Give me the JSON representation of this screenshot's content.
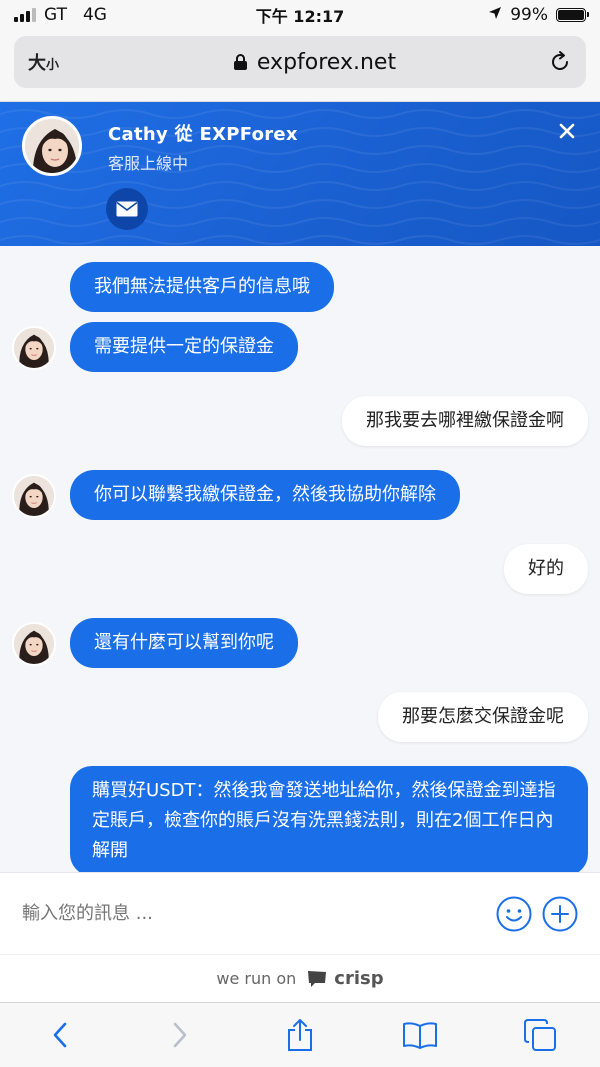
{
  "status_bar": {
    "carrier": "GT",
    "network": "4G",
    "time": "下午 12:17",
    "battery": "99%"
  },
  "browser": {
    "text_size_label": "大",
    "text_size_small": "小",
    "url": "expforex.net"
  },
  "chat": {
    "agent_name": "Cathy 從 EXPForex",
    "agent_status": "客服上線中",
    "messages": [
      {
        "from": "operator",
        "text": "我們無法提供客戶的信息哦"
      },
      {
        "from": "operator",
        "text": "需要提供一定的保證金"
      },
      {
        "from": "visitor",
        "text": "那我要去哪裡繳保證金啊"
      },
      {
        "from": "operator",
        "text": "你可以聯繫我繳保證金，然後我協助你解除"
      },
      {
        "from": "visitor",
        "text": "好的"
      },
      {
        "from": "operator",
        "text": "還有什麼可以幫到你呢"
      },
      {
        "from": "visitor",
        "text": "那要怎麼交保證金呢"
      },
      {
        "from": "operator",
        "text": "購買好USDT：然後我會發送地址給你，然後保證金到達指定賬戶，檢查你的賬戶沒有洗黑錢法則，則在2個工作日內解開"
      }
    ],
    "composer_placeholder": "輸入您的訊息 ...",
    "powered_prefix": "we run on",
    "powered_brand": "crisp"
  },
  "colors": {
    "accent": "#1a6ee8",
    "header_bg": "#1f6fe6",
    "mail_button": "#0d46a8"
  },
  "icons": [
    "lock-icon",
    "reload-icon",
    "close-icon",
    "mail-icon",
    "emoji-icon",
    "plus-icon",
    "back-icon",
    "forward-icon",
    "share-icon",
    "bookmarks-icon",
    "tabs-icon"
  ]
}
